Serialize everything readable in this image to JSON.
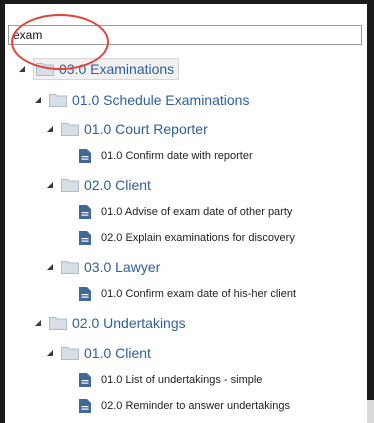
{
  "search": {
    "value": "exam",
    "placeholder": ""
  },
  "tree": {
    "examinations": "03.0 Examinations",
    "schedule": "01.0 Schedule Examinations",
    "court_reporter": "01.0 Court Reporter",
    "confirm_date_reporter": "01.0 Confirm date with reporter",
    "client": "02.0 Client",
    "advise_exam_date": "01.0 Advise of exam date of other party",
    "explain_examinations": "02.0 Explain examinations for discovery",
    "lawyer": "03.0 Lawyer",
    "confirm_exam_date": "01.0 Confirm exam date of his-her client",
    "undertakings": "02.0 Undertakings",
    "undertakings_client": "01.0 Client",
    "list_undertakings": "01.0 List of undertakings - simple",
    "reminder_undertakings": "02.0 Reminder to answer undertakings"
  },
  "colors": {
    "folder_label": "#2d5f9a",
    "highlight": "#e2433b",
    "frame": "#1b1b1b"
  },
  "icons": {
    "folder": "folder-icon",
    "document": "document-icon",
    "expanded": "expanded-triangle-icon"
  }
}
